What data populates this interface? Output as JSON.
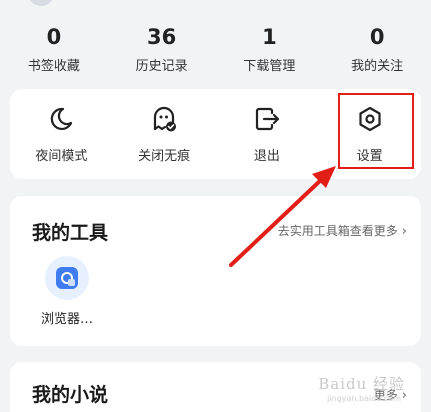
{
  "stats": [
    {
      "value": "0",
      "label": "书签收藏"
    },
    {
      "value": "36",
      "label": "历史记录"
    },
    {
      "value": "1",
      "label": "下载管理"
    },
    {
      "value": "0",
      "label": "我的关注"
    }
  ],
  "actions": [
    {
      "label": "夜间模式",
      "icon": "moon-icon"
    },
    {
      "label": "关闭无痕",
      "icon": "ghost-icon"
    },
    {
      "label": "退出",
      "icon": "exit-icon"
    },
    {
      "label": "设置",
      "icon": "gear-icon"
    }
  ],
  "tools": {
    "title": "我的工具",
    "link": "去实用工具箱查看更多",
    "items": [
      {
        "label": "浏览器…",
        "icon": "browser-app-icon"
      }
    ]
  },
  "novel": {
    "title": "我的小说",
    "link": "更多"
  },
  "watermark": {
    "text": "Baidu 经验",
    "sub": "jingyan.baidu.com"
  },
  "colors": {
    "highlight": "#e21f17",
    "accent": "#3f7bf1",
    "background": "#f2f3f5"
  }
}
